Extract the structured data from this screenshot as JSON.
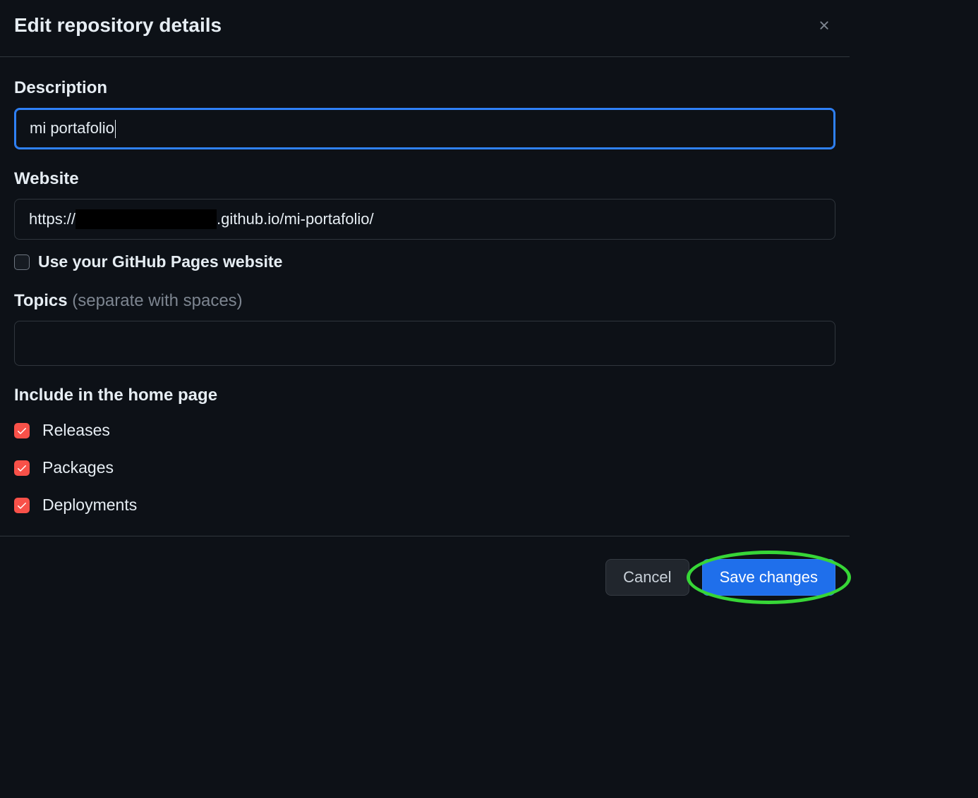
{
  "header": {
    "title": "Edit repository details"
  },
  "description": {
    "label": "Description",
    "value": "mi portafolio"
  },
  "website": {
    "label": "Website",
    "value_prefix": "https://",
    "value_suffix": ".github.io/mi-portafolio/",
    "use_pages_label": "Use your GitHub Pages website",
    "use_pages_checked": false
  },
  "topics": {
    "label": "Topics ",
    "hint": "(separate with spaces)",
    "value": ""
  },
  "include": {
    "heading": "Include in the home page",
    "items": [
      {
        "label": "Releases",
        "checked": true
      },
      {
        "label": "Packages",
        "checked": true
      },
      {
        "label": "Deployments",
        "checked": true
      }
    ]
  },
  "footer": {
    "cancel": "Cancel",
    "save": "Save changes"
  }
}
